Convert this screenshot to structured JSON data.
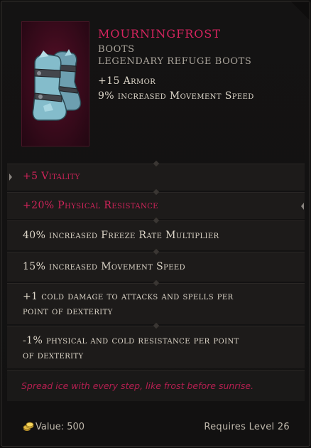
{
  "item": {
    "name": "MOURNINGFROST",
    "type": "BOOTS",
    "subtype": "LEGENDARY REFUGE BOOTS",
    "implicits": [
      "+15 Armor",
      "9% increased Movement Speed"
    ],
    "portrait_icon": "frost-boots-icon"
  },
  "affixes": [
    {
      "text": "+5 Vitality",
      "color": "#d2245b"
    },
    {
      "text": "+20% Physical Resistance",
      "color": "#d2245b"
    },
    {
      "text": "40% increased Freeze Rate Multiplier",
      "color": "#ddd6c9"
    },
    {
      "text": "15% increased Movement Speed",
      "color": "#ddd6c9"
    },
    {
      "text_lines": [
        "+1 cold damage to attacks and spells per",
        "point of dexterity"
      ],
      "color": "#ddd6c9"
    },
    {
      "text_lines": [
        "-1% physical and cold resistance per point",
        "of dexterity"
      ],
      "color": "#ddd6c9"
    }
  ],
  "lore": "Spread ice with every step, like frost before sunrise.",
  "footer": {
    "value_label": "Value: 500",
    "requirement": "Requires Level 26",
    "coin_icon": "gold-coin-icon"
  },
  "colors": {
    "legendary_name": "#d6245f",
    "sealed_affix": "#d2245b",
    "normal_affix": "#ddd6c9",
    "lore": "#b41f50"
  }
}
